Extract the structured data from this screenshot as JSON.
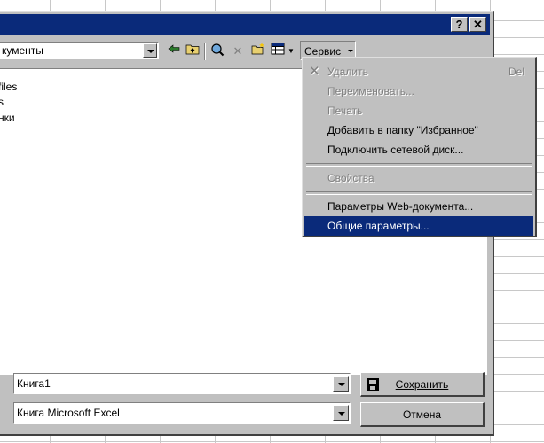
{
  "lookin": {
    "value": "кументы"
  },
  "toolbar": {
    "service_label": "Сервис"
  },
  "files": [
    "files",
    "s",
    "нки"
  ],
  "menu": {
    "items": [
      {
        "label": "Удалить",
        "shortcut": "Del",
        "state": "disabled",
        "icon": "x-icon"
      },
      {
        "label": "Переименовать...",
        "state": "disabled"
      },
      {
        "label": "Печать",
        "state": "disabled"
      },
      {
        "label": "Добавить в папку \"Избранное\"",
        "state": "enabled"
      },
      {
        "label": "Подключить сетевой диск...",
        "state": "enabled"
      },
      {
        "label": "Свойства",
        "state": "disabled"
      },
      {
        "label": "Параметры Web-документа...",
        "state": "enabled"
      },
      {
        "label": "Общие параметры...",
        "state": "selected"
      }
    ]
  },
  "filename": {
    "value": "Книга1"
  },
  "filetype": {
    "value": "Книга Microsoft Excel"
  },
  "buttons": {
    "save": "Сохранить",
    "cancel": "Отмена"
  },
  "titlebar": {
    "help": "?",
    "close": "✕"
  },
  "colors": {
    "selection": "#0a2a7a",
    "face": "#c0c0c0"
  }
}
